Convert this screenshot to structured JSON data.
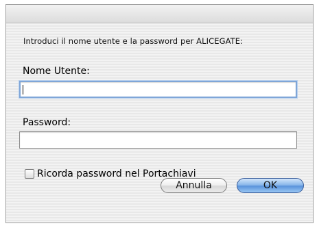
{
  "dialog": {
    "prompt": "Introduci il nome utente e la password per ALICEGATE:",
    "username_label": "Nome Utente:",
    "username_value": "",
    "password_label": "Password:",
    "password_value": "",
    "remember_label": "Ricorda password nel Portachiavi",
    "remember_checked": false,
    "cancel_label": "Annulla",
    "ok_label": "OK"
  },
  "colors": {
    "default_button": "#5b93dc",
    "focus_ring": "#7fa6d8"
  }
}
